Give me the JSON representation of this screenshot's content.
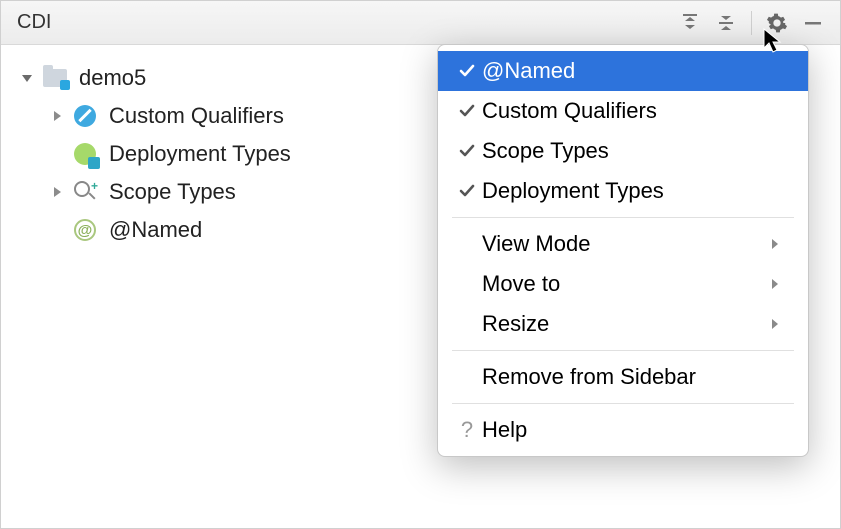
{
  "header": {
    "title": "CDI"
  },
  "tree": {
    "root": {
      "label": "demo5",
      "expanded": true
    },
    "children": [
      {
        "label": "Custom Qualifiers",
        "expandable": true
      },
      {
        "label": "Deployment Types",
        "expandable": false
      },
      {
        "label": "Scope Types",
        "expandable": true
      },
      {
        "label": "@Named",
        "expandable": false
      }
    ]
  },
  "menu": {
    "toggles": [
      {
        "label": "@Named",
        "checked": true,
        "selected": true
      },
      {
        "label": "Custom Qualifiers",
        "checked": true,
        "selected": false
      },
      {
        "label": "Scope Types",
        "checked": true,
        "selected": false
      },
      {
        "label": "Deployment Types",
        "checked": true,
        "selected": false
      }
    ],
    "actions": [
      {
        "label": "View Mode",
        "submenu": true
      },
      {
        "label": "Move to",
        "submenu": true
      },
      {
        "label": "Resize",
        "submenu": true
      }
    ],
    "remove_label": "Remove from Sidebar",
    "help_label": "Help"
  }
}
